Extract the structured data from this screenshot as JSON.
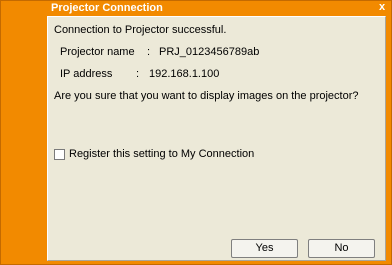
{
  "window": {
    "title": "Projector Connection",
    "close_label": "x"
  },
  "message": {
    "success": "Connection to Projector successful.",
    "projector_name_label": "Projector name",
    "projector_name_value": "PRJ_0123456789ab",
    "ip_label": "IP address",
    "ip_value": "192.168.1.100",
    "separator": ":",
    "question": "Are you sure that you want to display images on the projector?"
  },
  "register": {
    "label": "Register this setting to My Connection",
    "checked": false
  },
  "buttons": {
    "yes": "Yes",
    "no": "No"
  },
  "colors": {
    "accent": "#f28a00",
    "panel": "#ece9d8"
  }
}
